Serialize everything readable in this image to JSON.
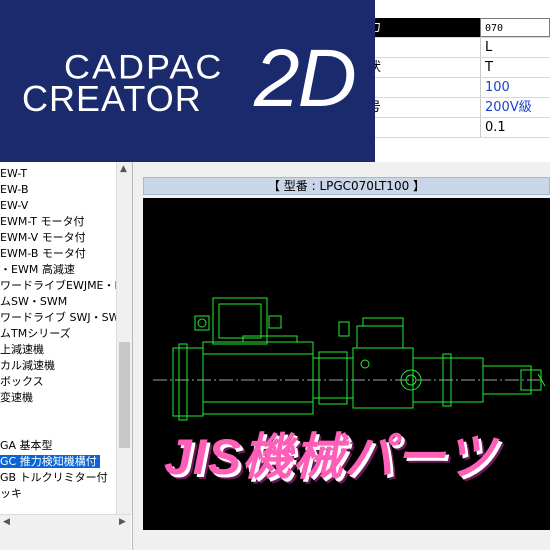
{
  "properties": {
    "rows": [
      {
        "key": "力",
        "value": "070",
        "style": "input"
      },
      {
        "key": "",
        "value": "L",
        "style": "black"
      },
      {
        "key": "状",
        "value": "T",
        "style": "black"
      },
      {
        "key": "",
        "value": "100",
        "style": "blue"
      },
      {
        "key": "号",
        "value": "200V級",
        "style": "blue"
      },
      {
        "key": ")",
        "value": "0.1",
        "style": "black"
      }
    ]
  },
  "logo": {
    "line1": "CADPAC",
    "line2": "CREATOR",
    "suffix": "2D"
  },
  "tree": {
    "items": [
      "EW-T",
      "EW-B",
      "EW-V",
      "EWM-T モータ付",
      "EWM-V モータ付",
      "EWM-B モータ付",
      "・EWM 高減速",
      "ワードライブEWJME・EWI",
      "ムSW・SWM",
      "ワードライブ SWJ・SWJM",
      "ムTMシリーズ",
      "上減速機",
      "カル減速機",
      "ボックス",
      "変速機",
      "",
      "",
      "GA 基本型",
      "GC 推力検知機構付",
      "GB トルクリミター付",
      "ッキ"
    ],
    "selected_index": 18
  },
  "main": {
    "caption": "【 型番 : LPGC070LT100 】",
    "overlay_title": "JIS機械パーツ"
  },
  "colors": {
    "logo_bg": "#1a2a6c",
    "cad_bg": "#000000",
    "cad_lines": "#22ee33",
    "selection": "#0a64d6",
    "overlay_text": "#ff5fb8"
  }
}
